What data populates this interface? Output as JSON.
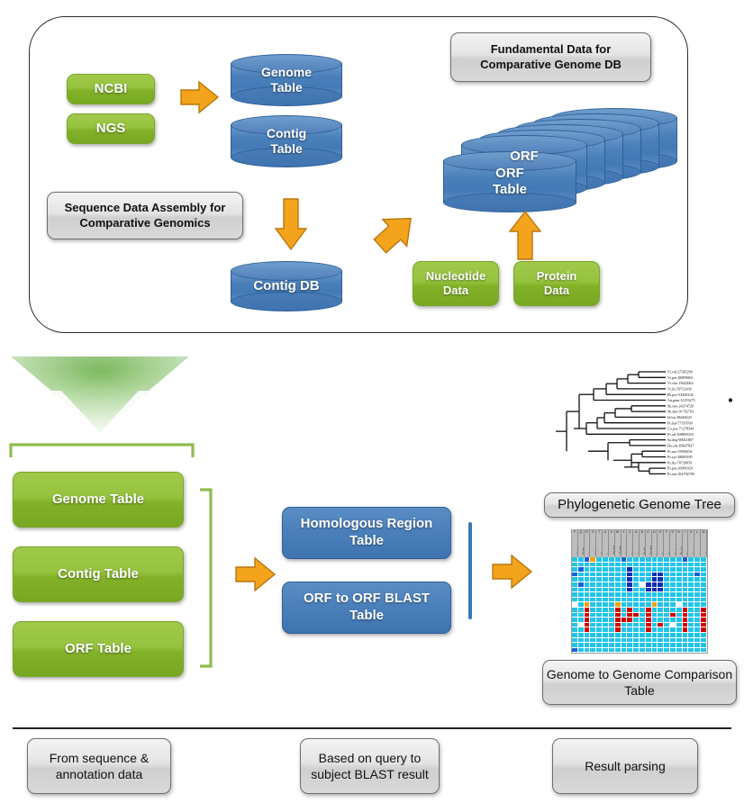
{
  "top_panel": {
    "sources": [
      {
        "label": "NCBI",
        "name": "ncbi"
      },
      {
        "label": "NGS",
        "name": "ngs"
      }
    ],
    "cylinders": [
      {
        "label": "Genome\nTable",
        "name": "genome-table"
      },
      {
        "label": "Contig\nTable",
        "name": "contig-table"
      },
      {
        "label": "Contig DB",
        "name": "contig-db"
      },
      {
        "label": "ORF\nTable",
        "name": "orf-table"
      },
      {
        "label": "ORF",
        "name": "orf-stack"
      }
    ],
    "callouts": [
      {
        "label": "Fundamental Data for Comparative Genome DB",
        "name": "fundamental-data"
      },
      {
        "label": "Sequence Data Assembly for Comparative Genomics",
        "name": "sequence-assembly"
      }
    ],
    "data_inputs": [
      {
        "label": "Nucleotide\nData",
        "name": "nucleotide-data"
      },
      {
        "label": "Protein\nData",
        "name": "protein-data"
      }
    ]
  },
  "middle": {
    "input_tables": [
      {
        "label": "Genome Table",
        "name": "genome-table"
      },
      {
        "label": "Contig Table",
        "name": "contig-table"
      },
      {
        "label": "ORF Table",
        "name": "orf-table"
      }
    ],
    "result_tables": [
      {
        "label": "Homologous Region Table",
        "name": "homologous-region-table"
      },
      {
        "label": "ORF to ORF BLAST Table",
        "name": "orf-to-orf-blast-table"
      }
    ],
    "outputs": [
      {
        "label": "Phylogenetic Genome Tree",
        "name": "phylogenetic-genome-tree"
      },
      {
        "label": "Genome to Genome Comparison Table",
        "name": "genome-to-genome-comparison-table"
      }
    ]
  },
  "footer": {
    "notes": [
      {
        "label": "From sequence & annotation data",
        "name": "from-sequence-annotation"
      },
      {
        "label": "Based on query to subject BLAST result",
        "name": "based-on-query-blast"
      },
      {
        "label": "Result parsing",
        "name": "result-parsing"
      }
    ]
  },
  "phylo_tree": {
    "leaves": [
      "Vi.vul-27365299",
      "Vi.par-28899004",
      "Vi.cho-15642064",
      "Vi.fis-59712439",
      "Ph.pro-54308134",
      "An.gam-31193275",
      "Sh.one-24374720",
      "Sh.den-91792703",
      "Id.los-86460223",
      "Ps.hal-77359760",
      "Co.psy-71278344",
      "Ps.atl-108890333",
      "Sa.deg-90021807",
      "Ha.che-83647837",
      "Ps.aer-15596654",
      "Ps.syr-28869185",
      "Ps.flu-70729059",
      "Ps.put-26991029",
      "Ps.ent-104782799"
    ],
    "marked_leaf": "An.gam-31193275"
  },
  "heatmap": {
    "column_codes": [
      "F",
      "Q",
      "R",
      "S",
      "T",
      "U",
      "V",
      "W",
      "Y",
      "Z",
      "A",
      "B",
      "C",
      "D",
      "E",
      "F",
      "G",
      "H",
      "I",
      "K",
      "L",
      "M"
    ],
    "column_labels": [
      "Vi.vul",
      "Vi.par",
      "Vi.cho",
      "Vi.fis",
      "Ph.pro",
      "An.gam",
      "Sh.one",
      "Sh.den",
      "Id.los",
      "Ps.hal",
      "Co.psy",
      "Ps.atl",
      "Sa.deg",
      "Ha.che",
      "Ps.aer",
      "Ps.syr",
      "Ps.flu",
      "Ps.put",
      "Ps.ent",
      "Es.col",
      "Ye.pes",
      "Sa.typ"
    ],
    "palette": {
      "cyan": "#21c4e8",
      "light_cyan": "#5fd9f0",
      "blue": "#1560d8",
      "dark_blue": "#0b2fb0",
      "red": "#d00000",
      "orange": "#f5a000",
      "white": "#ffffff",
      "header_gray": "#bdbdbd"
    },
    "rows": 19,
    "cols": 22,
    "cells": [
      [
        "c",
        "c",
        "b",
        "o",
        "c",
        "c",
        "c",
        "c",
        "b",
        "c",
        "c",
        "c",
        "c",
        "c",
        "c",
        "c",
        "c",
        "c",
        "b",
        "c",
        "c",
        "c"
      ],
      [
        "c",
        "c",
        "c",
        "c",
        "c",
        "c",
        "c",
        "c",
        "c",
        "c",
        "c",
        "c",
        "c",
        "c",
        "c",
        "c",
        "c",
        "c",
        "c",
        "c",
        "c",
        "c"
      ],
      [
        "c",
        "b",
        "c",
        "c",
        "c",
        "c",
        "c",
        "c",
        "c",
        "B",
        "c",
        "c",
        "c",
        "c",
        "c",
        "c",
        "c",
        "c",
        "c",
        "c",
        "c",
        "c"
      ],
      [
        "b",
        "c",
        "c",
        "c",
        "c",
        "c",
        "c",
        "c",
        "c",
        "B",
        "c",
        "c",
        "c",
        "B",
        "B",
        "c",
        "c",
        "c",
        "c",
        "c",
        "b",
        "c"
      ],
      [
        "c",
        "c",
        "c",
        "c",
        "c",
        "c",
        "c",
        "c",
        "c",
        "B",
        "c",
        "c",
        "c",
        "B",
        "B",
        "c",
        "c",
        "c",
        "c",
        "c",
        "c",
        "c"
      ],
      [
        "c",
        "b",
        "c",
        "c",
        "c",
        "c",
        "c",
        "c",
        "c",
        "B",
        "c",
        "w",
        "B",
        "B",
        "B",
        "c",
        "c",
        "c",
        "c",
        "c",
        "c",
        "c"
      ],
      [
        "c",
        "c",
        "c",
        "c",
        "c",
        "c",
        "c",
        "c",
        "c",
        "B",
        "c",
        "c",
        "B",
        "B",
        "B",
        "c",
        "c",
        "c",
        "c",
        "c",
        "c",
        "c"
      ],
      [
        "c",
        "c",
        "c",
        "c",
        "c",
        "c",
        "c",
        "c",
        "c",
        "c",
        "c",
        "c",
        "c",
        "c",
        "c",
        "c",
        "c",
        "c",
        "c",
        "c",
        "c",
        "c"
      ],
      [
        "c",
        "c",
        "c",
        "c",
        "c",
        "c",
        "c",
        "c",
        "c",
        "c",
        "c",
        "c",
        "c",
        "c",
        "c",
        "c",
        "c",
        "c",
        "c",
        "c",
        "c",
        "c"
      ],
      [
        "w",
        "c",
        "o",
        "c",
        "c",
        "c",
        "c",
        "o",
        "c",
        "c",
        "c",
        "c",
        "c",
        "o",
        "c",
        "c",
        "c",
        "w",
        "c",
        "c",
        "c",
        "c"
      ],
      [
        "c",
        "c",
        "R",
        "c",
        "c",
        "c",
        "c",
        "R",
        "c",
        "R",
        "c",
        "c",
        "R",
        "c",
        "c",
        "c",
        "c",
        "c",
        "R",
        "c",
        "c",
        "R"
      ],
      [
        "c",
        "c",
        "R",
        "c",
        "c",
        "c",
        "c",
        "R",
        "c",
        "R",
        "R",
        "c",
        "R",
        "c",
        "c",
        "c",
        "R",
        "c",
        "R",
        "c",
        "c",
        "R"
      ],
      [
        "c",
        "c",
        "R",
        "c",
        "c",
        "c",
        "c",
        "R",
        "R",
        "R",
        "c",
        "c",
        "R",
        "c",
        "c",
        "c",
        "c",
        "c",
        "R",
        "c",
        "c",
        "R"
      ],
      [
        "c",
        "w",
        "R",
        "c",
        "c",
        "c",
        "c",
        "R",
        "c",
        "c",
        "c",
        "c",
        "R",
        "c",
        "R",
        "c",
        "w",
        "c",
        "R",
        "c",
        "c",
        "R"
      ],
      [
        "c",
        "c",
        "R",
        "c",
        "c",
        "c",
        "c",
        "R",
        "c",
        "c",
        "c",
        "c",
        "R",
        "c",
        "c",
        "c",
        "c",
        "c",
        "R",
        "c",
        "c",
        "R"
      ],
      [
        "c",
        "c",
        "c",
        "c",
        "c",
        "c",
        "c",
        "c",
        "c",
        "c",
        "c",
        "c",
        "c",
        "c",
        "c",
        "c",
        "c",
        "c",
        "c",
        "c",
        "c",
        "c"
      ],
      [
        "c",
        "c",
        "c",
        "c",
        "c",
        "c",
        "c",
        "c",
        "c",
        "c",
        "c",
        "c",
        "c",
        "c",
        "c",
        "c",
        "c",
        "c",
        "c",
        "c",
        "c",
        "c"
      ],
      [
        "c",
        "c",
        "c",
        "c",
        "c",
        "c",
        "c",
        "c",
        "c",
        "c",
        "c",
        "c",
        "c",
        "c",
        "c",
        "c",
        "c",
        "c",
        "c",
        "c",
        "c",
        "c"
      ],
      [
        "b",
        "c",
        "c",
        "c",
        "c",
        "c",
        "c",
        "c",
        "c",
        "c",
        "c",
        "c",
        "c",
        "c",
        "c",
        "c",
        "c",
        "c",
        "c",
        "c",
        "c",
        "c"
      ]
    ]
  }
}
